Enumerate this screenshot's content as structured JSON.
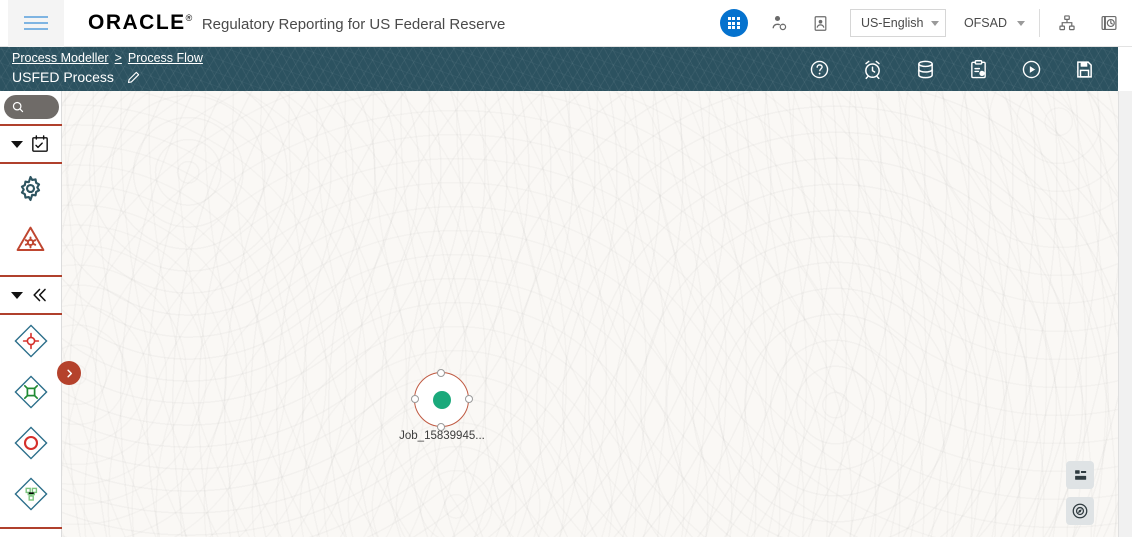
{
  "header": {
    "menu_label": "menu",
    "logo_text": "ORACLE",
    "logo_registered": "®",
    "app_title": "Regulatory Reporting for US Federal Reserve",
    "apps_icon": "grid-apps-icon",
    "user_admin_icon": "user-admin-icon",
    "id_card_icon": "id-card-icon",
    "language": {
      "value": "US-English",
      "options": [
        "US-English"
      ]
    },
    "workspace": {
      "value": "OFSAD",
      "options": [
        "OFSAD"
      ]
    },
    "hierarchy_icon": "org-hierarchy-icon",
    "history_icon": "clock-history-icon"
  },
  "subbar": {
    "breadcrumb": [
      {
        "label": "Process Modeller"
      },
      {
        "label": ">"
      },
      {
        "label": "Process Flow"
      }
    ],
    "flow_title": "USFED Process",
    "edit_icon": "pencil-edit-icon",
    "tools": [
      {
        "name": "help-icon",
        "title": "Help"
      },
      {
        "name": "alarm-clock-icon",
        "title": "Schedule"
      },
      {
        "name": "database-icon",
        "title": "Data"
      },
      {
        "name": "clipboard-report-icon",
        "title": "Report"
      },
      {
        "name": "run-play-icon",
        "title": "Run"
      },
      {
        "name": "save-icon",
        "title": "Save"
      }
    ]
  },
  "sidebar": {
    "search": {
      "value": "",
      "placeholder": "",
      "icon": "search-icon"
    },
    "sections": [
      {
        "name": "tasks",
        "collapse_icon": "triangle-down-icon",
        "header_icon": "calendar-task-icon",
        "items": [
          {
            "name": "settings-gear-icon",
            "label": "Settings"
          },
          {
            "name": "warning-gear-icon",
            "label": "Alert Rule"
          }
        ]
      },
      {
        "name": "palette",
        "collapse_icon": "triangle-down-icon",
        "header_icon": "double-chevron-left-icon",
        "items": [
          {
            "name": "palette-start-node-icon",
            "label": "Start"
          },
          {
            "name": "palette-task-node-icon",
            "label": "Task"
          },
          {
            "name": "palette-end-node-icon",
            "label": "End"
          },
          {
            "name": "palette-subprocess-node-icon",
            "label": "Sub Process"
          }
        ]
      }
    ],
    "expander_icon": "chevron-right-icon"
  },
  "canvas": {
    "nodes": [
      {
        "id": "job-node",
        "label": "Job_15839945...",
        "status_color": "#1aa97b",
        "border_color": "#c05a42"
      }
    ],
    "fabs": [
      {
        "name": "legend-icon",
        "title": "Legend"
      },
      {
        "name": "navigator-compass-icon",
        "title": "Navigator"
      }
    ]
  },
  "colors": {
    "teal_bar": "#2c5260",
    "accent_red": "#b0402c",
    "accent_blue": "#0572ce",
    "node_green": "#1aa97b",
    "canvas_bg": "#faf8f5"
  }
}
